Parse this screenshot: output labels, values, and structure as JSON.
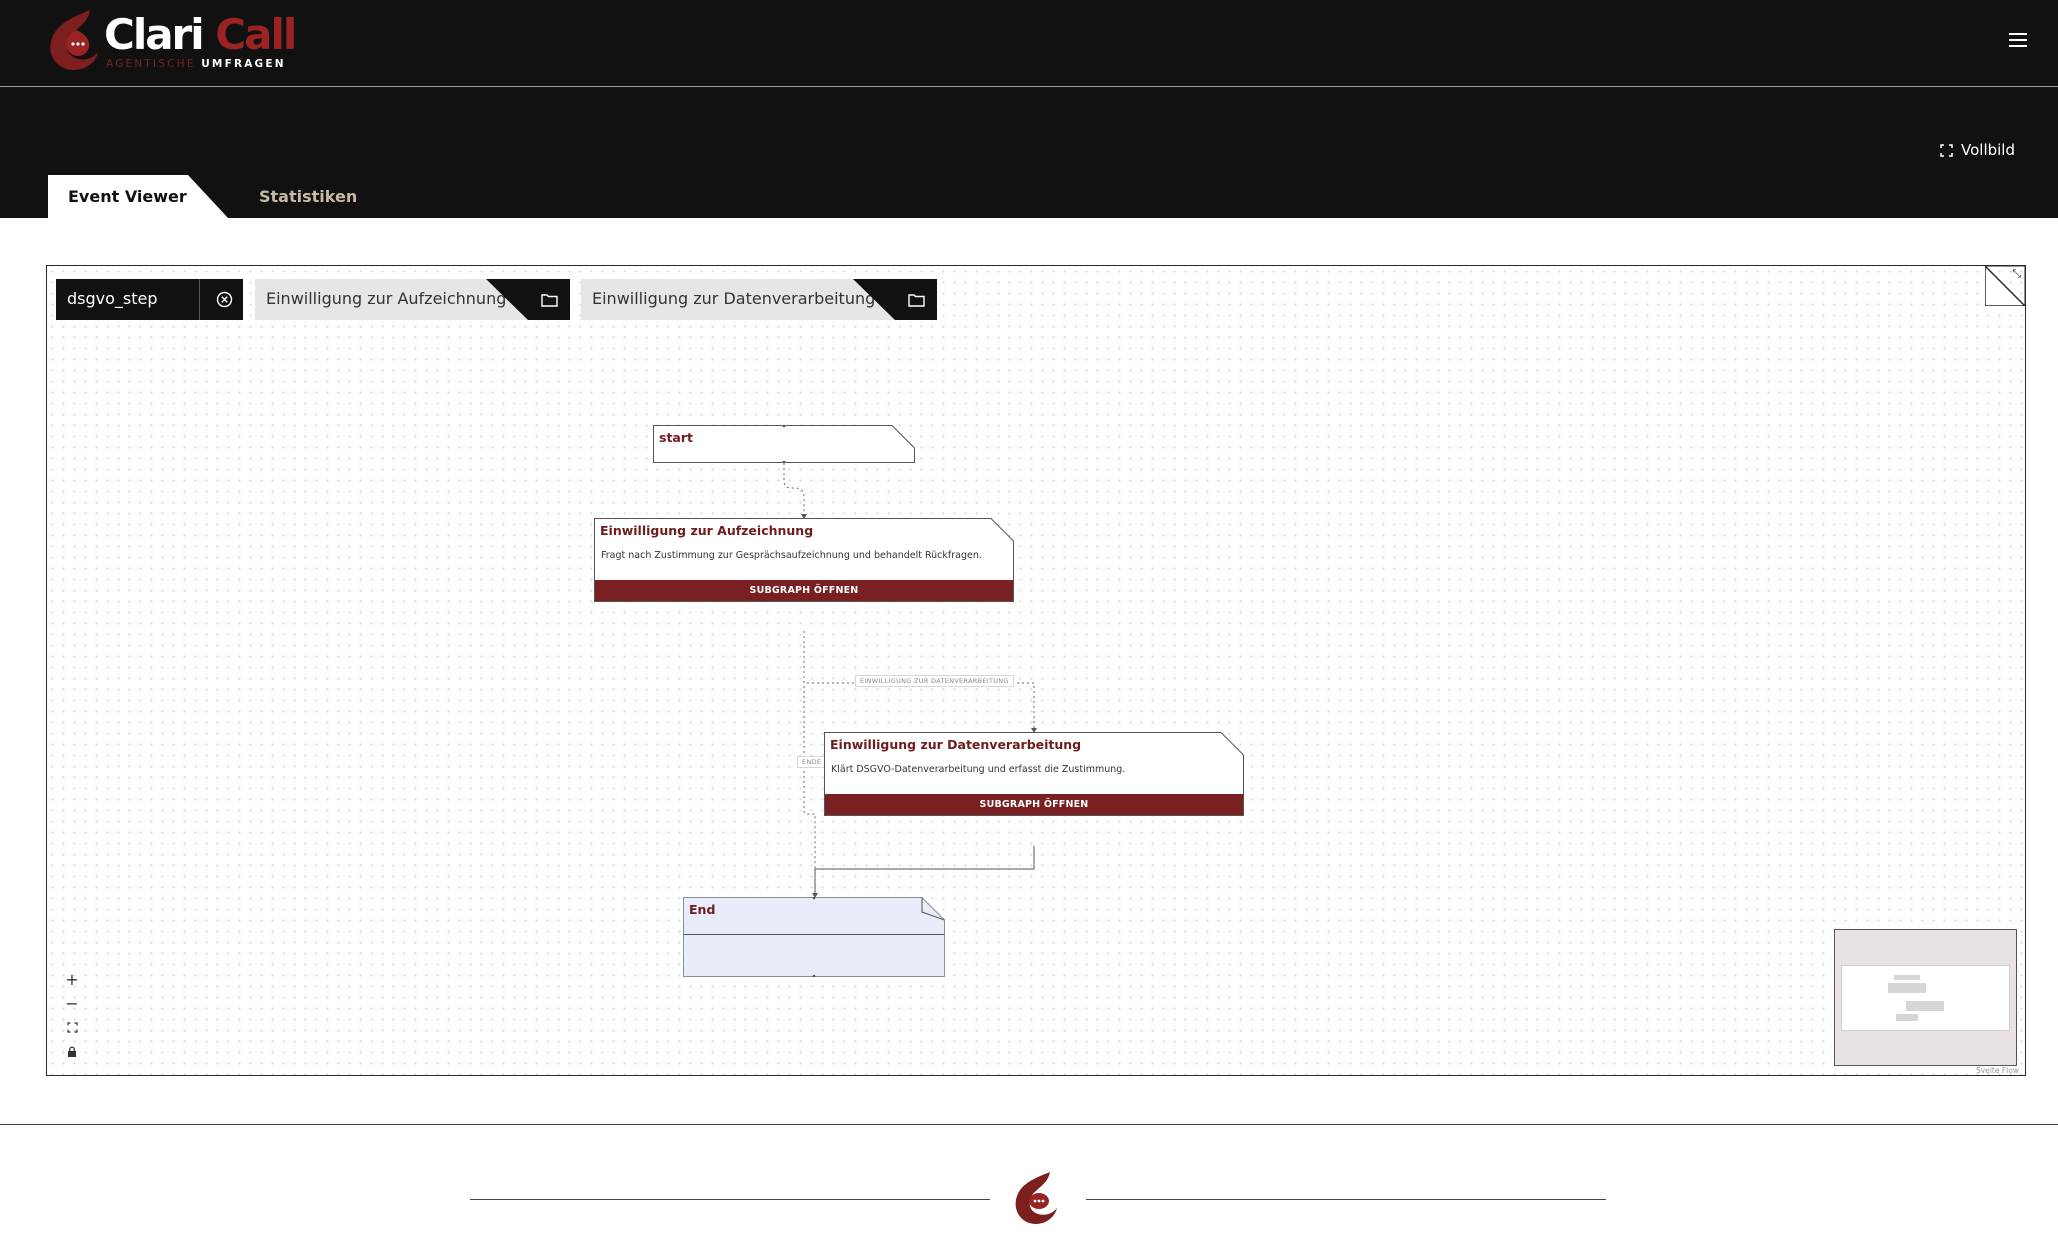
{
  "header": {
    "logo_word_1": "Clari",
    "logo_word_2": " Call",
    "logo_tag_1": "AGENTISCHE ",
    "logo_tag_2": "UMFRAGEN"
  },
  "toolbar": {
    "fullscreen_label": "Vollbild"
  },
  "tabs": [
    {
      "label": "Event Viewer",
      "active": true
    },
    {
      "label": "Statistiken",
      "active": false
    }
  ],
  "breadcrumb": {
    "root": "dsgvo_step",
    "items": [
      {
        "label": "Einwilligung zur Aufzeichnung"
      },
      {
        "label": "Einwilligung zur Datenverarbeitung"
      }
    ]
  },
  "nodes": {
    "start": {
      "title": "start"
    },
    "sub1": {
      "title": "Einwilligung zur Aufzeichnung",
      "description": "Fragt nach Zustimmung zur Gesprächsaufzeichnung und behandelt Rückfragen.",
      "button": "SUBGRAPH ÖFFNEN"
    },
    "sub2": {
      "title": "Einwilligung zur Datenverarbeitung",
      "description": "Klärt DSGVO-Datenverarbeitung und erfasst die Zustimmung.",
      "button": "SUBGRAPH ÖFFNEN"
    },
    "end": {
      "title": "End"
    }
  },
  "edge_labels": {
    "to_sub2": "EINWILLIGUNG ZUR DATENVERARBEITUNG",
    "to_end": "ENDE"
  },
  "attribution": "Svelte Flow",
  "colors": {
    "brand_red": "#9b2323",
    "button_red": "#7a1f22",
    "dark_bg": "#111111",
    "end_node_fill": "#e8edf9"
  }
}
